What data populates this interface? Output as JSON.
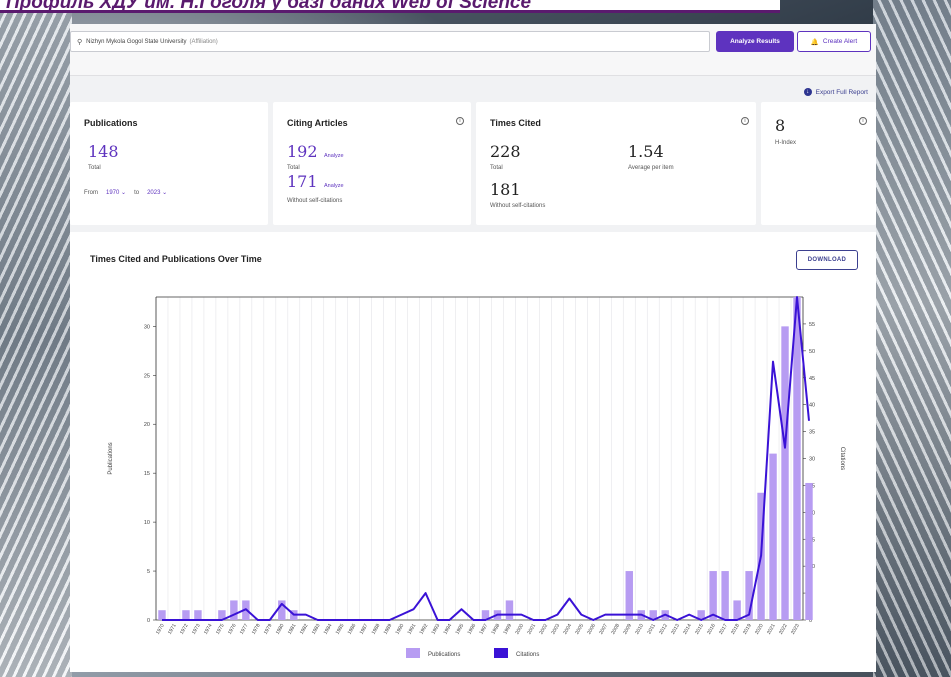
{
  "banner": {
    "title": "Профиль ХДУ им. Н.Гоголя у базі даних Web of Science"
  },
  "search": {
    "query": "Nizhyn Mykola Gogol State University",
    "field": "(Affiliation)"
  },
  "toolbar": {
    "analyze_label": "Analyze Results",
    "alert_label": "Create Alert"
  },
  "export_label": "Export Full Report",
  "publications": {
    "title": "Publications",
    "total": "148",
    "total_label": "Total",
    "from_label": "From",
    "from_value": "1970",
    "to_label": "to",
    "to_value": "2023"
  },
  "citing": {
    "title": "Citing Articles",
    "total": "192",
    "analyze": "Analyze",
    "total_label": "Total",
    "without": "171",
    "without_label": "Without self-citations"
  },
  "times_cited": {
    "title": "Times Cited",
    "total": "228",
    "total_label": "Total",
    "avg": "1.54",
    "avg_label": "Average per item",
    "without": "181",
    "without_label": "Without self-citations"
  },
  "hindex": {
    "value": "8",
    "label": "H-Index"
  },
  "chart_section": {
    "title": "Times Cited and Publications Over Time",
    "download_label": "DOWNLOAD"
  },
  "colors": {
    "accent": "#5e33bf",
    "bars": "#b79cf2",
    "line": "#3a12d6"
  },
  "chart_data": {
    "type": "bar",
    "categories": [
      "1970",
      "1971",
      "1972",
      "1973",
      "1974",
      "1975",
      "1976",
      "1977",
      "1978",
      "1979",
      "1980",
      "1981",
      "1982",
      "1983",
      "1984",
      "1985",
      "1986",
      "1987",
      "1988",
      "1989",
      "1990",
      "1991",
      "1992",
      "1993",
      "1994",
      "1995",
      "1996",
      "1997",
      "1998",
      "1999",
      "2000",
      "2001",
      "2002",
      "2003",
      "2004",
      "2005",
      "2006",
      "2007",
      "2008",
      "2009",
      "2010",
      "2011",
      "2012",
      "2013",
      "2014",
      "2015",
      "2016",
      "2017",
      "2018",
      "2019",
      "2020",
      "2021",
      "2022",
      "2023"
    ],
    "series": [
      {
        "name": "Publications",
        "type": "bar",
        "axis": "left",
        "values": [
          1,
          0,
          1,
          1,
          0,
          1,
          2,
          2,
          0,
          0,
          2,
          1,
          0,
          0,
          0,
          0,
          0,
          0,
          0,
          0,
          0,
          0,
          0,
          0,
          0,
          0,
          0,
          1,
          1,
          2,
          0,
          0,
          0,
          0,
          0,
          0,
          0,
          0,
          0,
          5,
          1,
          1,
          1,
          0,
          0,
          1,
          5,
          5,
          2,
          5,
          13,
          17,
          30,
          33,
          14
        ]
      },
      {
        "name": "Citations",
        "type": "line",
        "axis": "right",
        "values": [
          0,
          0,
          0,
          0,
          0,
          0,
          1,
          2,
          0,
          0,
          3,
          1,
          1,
          0,
          0,
          0,
          0,
          0,
          0,
          0,
          1,
          2,
          5,
          0,
          0,
          2,
          0,
          0,
          1,
          1,
          1,
          0,
          0,
          1,
          4,
          1,
          0,
          1,
          1,
          1,
          1,
          0,
          1,
          0,
          1,
          0,
          1,
          0,
          0,
          1,
          12,
          48,
          32,
          60,
          37
        ]
      }
    ],
    "ylabel_left": "Publications",
    "ylabel_right": "Citations",
    "ylim_left": [
      0,
      33
    ],
    "yticks_left": [
      0,
      5,
      10,
      15,
      20,
      25,
      30
    ],
    "ylim_right": [
      0,
      60
    ],
    "yticks_right": [
      0,
      5,
      10,
      15,
      20,
      25,
      30,
      35,
      40,
      45,
      50,
      55
    ],
    "grid": "vertical",
    "legend": "bottom-center"
  }
}
